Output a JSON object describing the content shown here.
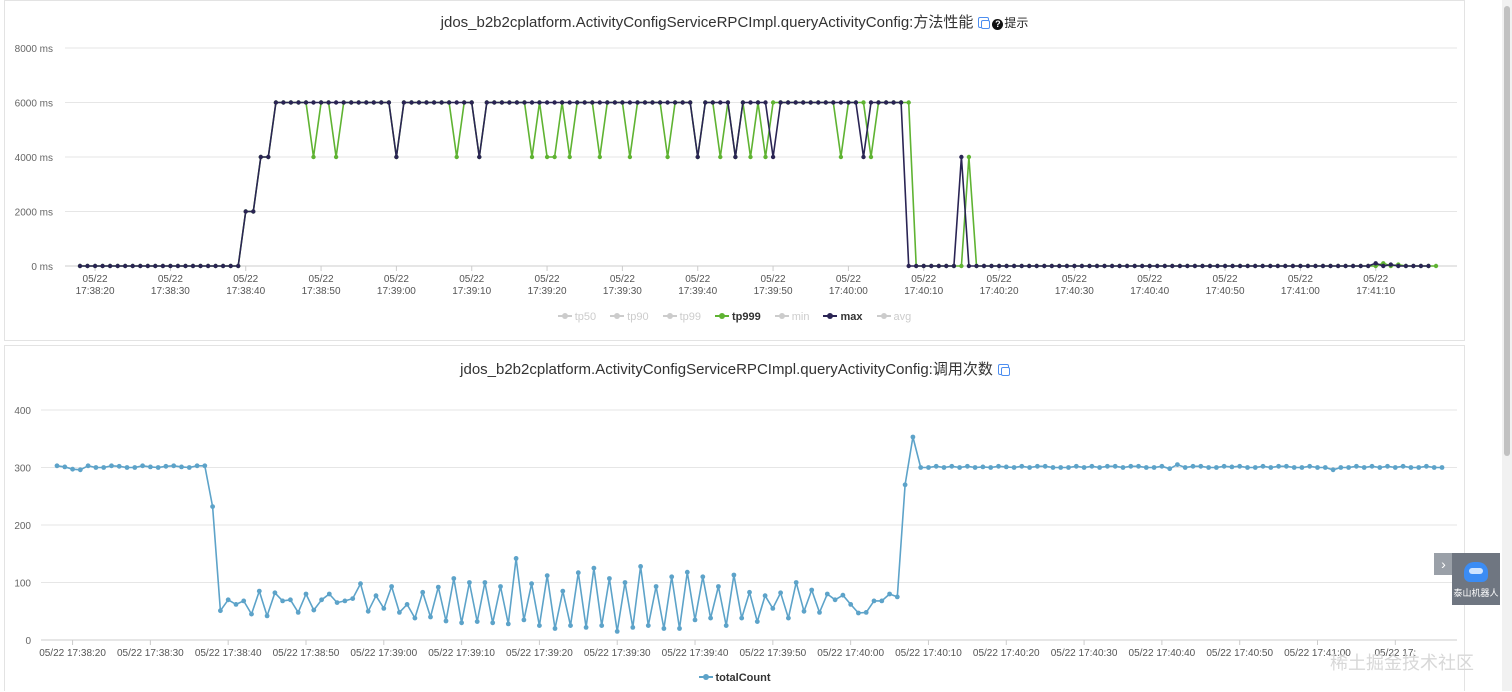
{
  "charts_panel1": {
    "title": "jdos_b2b2cplatform.ActivityConfigServiceRPCImpl.queryActivityConfig:方法性能",
    "help_label": "提示",
    "legend": [
      {
        "name": "tp50",
        "active": false,
        "color": "#cccccc"
      },
      {
        "name": "tp90",
        "active": false,
        "color": "#cccccc"
      },
      {
        "name": "tp99",
        "active": false,
        "color": "#cccccc"
      },
      {
        "name": "tp999",
        "active": true,
        "color": "#5fb332"
      },
      {
        "name": "min",
        "active": false,
        "color": "#cccccc"
      },
      {
        "name": "max",
        "active": true,
        "color": "#2a2454"
      },
      {
        "name": "avg",
        "active": false,
        "color": "#cccccc"
      }
    ]
  },
  "charts_panel2": {
    "title": "jdos_b2b2cplatform.ActivityConfigServiceRPCImpl.queryActivityConfig:调用次数",
    "legend": [
      {
        "name": "totalCount",
        "active": true,
        "color": "#5da3c9"
      }
    ]
  },
  "chart_data": [
    {
      "type": "line",
      "title": "jdos_b2b2cplatform.ActivityConfigServiceRPCImpl.queryActivityConfig:方法性能",
      "y_unit": "ms",
      "y_ticks": [
        "8000 ms",
        "6000 ms",
        "4000 ms",
        "2000 ms",
        "0 ms"
      ],
      "ylim": [
        0,
        8000
      ],
      "x_ticks": [
        "05/22 17:38:20",
        "05/22 17:38:30",
        "05/22 17:38:40",
        "05/22 17:38:50",
        "05/22 17:39:00",
        "05/22 17:39:10",
        "05/22 17:39:20",
        "05/22 17:39:30",
        "05/22 17:39:40",
        "05/22 17:39:50",
        "05/22 17:40:00",
        "05/22 17:40:10",
        "05/22 17:40:20",
        "05/22 17:40:30",
        "05/22 17:40:40",
        "05/22 17:40:50",
        "05/22 17:41:00",
        "05/22 17:41:10"
      ],
      "x_start": "05/22 17:38:18",
      "x_step_seconds": 1,
      "series": [
        {
          "name": "tp999",
          "values": [
            0,
            0,
            0,
            0,
            0,
            0,
            0,
            0,
            0,
            0,
            0,
            0,
            0,
            0,
            0,
            0,
            0,
            0,
            0,
            0,
            0,
            0,
            2000,
            2000,
            4000,
            4000,
            6000,
            6000,
            6000,
            6000,
            6000,
            4000,
            6000,
            6000,
            4000,
            6000,
            6000,
            6000,
            6000,
            6000,
            6000,
            6000,
            4000,
            6000,
            6000,
            6000,
            6000,
            6000,
            6000,
            6000,
            4000,
            6000,
            6000,
            4000,
            6000,
            6000,
            6000,
            6000,
            6000,
            6000,
            4000,
            6000,
            4000,
            4000,
            6000,
            4000,
            6000,
            6000,
            6000,
            4000,
            6000,
            6000,
            6000,
            4000,
            6000,
            6000,
            6000,
            6000,
            4000,
            6000,
            6000,
            6000,
            4000,
            6000,
            6000,
            4000,
            6000,
            4000,
            6000,
            4000,
            6000,
            4000,
            6000,
            6000,
            6000,
            6000,
            6000,
            6000,
            6000,
            6000,
            6000,
            4000,
            6000,
            6000,
            6000,
            4000,
            6000,
            6000,
            6000,
            6000,
            6000,
            0,
            0,
            0,
            0,
            0,
            0,
            0,
            4000,
            0,
            0,
            0,
            0,
            0,
            0,
            0,
            0,
            0,
            0,
            0,
            0,
            0,
            0,
            0,
            0,
            0,
            0,
            0,
            0,
            0,
            0,
            0,
            0,
            0,
            0,
            0,
            0,
            0,
            0,
            0,
            0,
            0,
            0,
            0,
            0,
            0,
            0,
            0,
            0,
            0,
            0,
            0,
            0,
            0,
            0,
            0,
            0,
            0,
            0,
            0,
            0,
            0,
            0,
            100,
            0,
            50,
            0,
            0,
            0,
            0,
            0
          ]
        },
        {
          "name": "max",
          "values": [
            0,
            0,
            0,
            0,
            0,
            0,
            0,
            0,
            0,
            0,
            0,
            0,
            0,
            0,
            0,
            0,
            0,
            0,
            0,
            0,
            0,
            0,
            2000,
            2000,
            4000,
            4000,
            6000,
            6000,
            6000,
            6000,
            6000,
            6000,
            6000,
            6000,
            6000,
            6000,
            6000,
            6000,
            6000,
            6000,
            6000,
            6000,
            4000,
            6000,
            6000,
            6000,
            6000,
            6000,
            6000,
            6000,
            6000,
            6000,
            6000,
            4000,
            6000,
            6000,
            6000,
            6000,
            6000,
            6000,
            6000,
            6000,
            6000,
            6000,
            6000,
            6000,
            6000,
            6000,
            6000,
            6000,
            6000,
            6000,
            6000,
            6000,
            6000,
            6000,
            6000,
            6000,
            6000,
            6000,
            6000,
            6000,
            4000,
            6000,
            6000,
            6000,
            6000,
            4000,
            6000,
            6000,
            6000,
            6000,
            4000,
            6000,
            6000,
            6000,
            6000,
            6000,
            6000,
            6000,
            6000,
            6000,
            6000,
            6000,
            4000,
            6000,
            6000,
            6000,
            6000,
            6000,
            0,
            0,
            0,
            0,
            0,
            0,
            0,
            4000,
            0,
            0,
            0,
            0,
            0,
            0,
            0,
            0,
            0,
            0,
            0,
            0,
            0,
            0,
            0,
            0,
            0,
            0,
            0,
            0,
            0,
            0,
            0,
            0,
            0,
            0,
            0,
            0,
            0,
            0,
            0,
            0,
            0,
            0,
            0,
            0,
            0,
            0,
            0,
            0,
            0,
            0,
            0,
            0,
            0,
            0,
            0,
            0,
            0,
            0,
            0,
            0,
            0,
            0,
            100,
            0,
            50,
            0,
            0,
            0,
            0,
            0
          ]
        }
      ]
    },
    {
      "type": "line",
      "title": "jdos_b2b2cplatform.ActivityConfigServiceRPCImpl.queryActivityConfig:调用次数",
      "y_ticks": [
        "400",
        "300",
        "200",
        "100",
        "0"
      ],
      "ylim": [
        0,
        400
      ],
      "x_ticks": [
        "05/22 17:38:20",
        "05/22 17:38:30",
        "05/22 17:38:40",
        "05/22 17:38:50",
        "05/22 17:39:00",
        "05/22 17:39:10",
        "05/22 17:39:20",
        "05/22 17:39:30",
        "05/22 17:39:40",
        "05/22 17:39:50",
        "05/22 17:40:00",
        "05/22 17:40:10",
        "05/22 17:40:20",
        "05/22 17:40:30",
        "05/22 17:40:40",
        "05/22 17:40:50",
        "05/22 17:41:00",
        "05/22 17:"
      ],
      "x_start": "05/22 17:38:18",
      "x_step_seconds": 1,
      "series": [
        {
          "name": "totalCount",
          "values": [
            303,
            301,
            297,
            296,
            303,
            300,
            300,
            303,
            302,
            300,
            300,
            303,
            301,
            300,
            302,
            303,
            301,
            300,
            303,
            303,
            232,
            51,
            70,
            62,
            68,
            45,
            85,
            42,
            82,
            68,
            70,
            48,
            80,
            52,
            70,
            80,
            65,
            68,
            72,
            98,
            50,
            77,
            55,
            93,
            48,
            62,
            38,
            83,
            40,
            92,
            33,
            107,
            30,
            100,
            32,
            100,
            30,
            93,
            28,
            142,
            35,
            98,
            25,
            112,
            20,
            85,
            25,
            117,
            22,
            125,
            25,
            107,
            15,
            100,
            22,
            128,
            25,
            93,
            20,
            110,
            20,
            118,
            35,
            110,
            38,
            93,
            25,
            113,
            38,
            83,
            32,
            77,
            55,
            82,
            38,
            100,
            50,
            87,
            48,
            80,
            70,
            78,
            62,
            47,
            48,
            68,
            68,
            80,
            75,
            270,
            353,
            300,
            300,
            302,
            300,
            302,
            300,
            302,
            300,
            301,
            300,
            302,
            301,
            300,
            302,
            300,
            302,
            302,
            300,
            300,
            300,
            302,
            300,
            302,
            300,
            302,
            302,
            300,
            302,
            302,
            300,
            300,
            302,
            298,
            305,
            300,
            302,
            302,
            300,
            300,
            302,
            301,
            302,
            300,
            300,
            302,
            300,
            302,
            302,
            300,
            300,
            302,
            300,
            300,
            296,
            300,
            300,
            302,
            300,
            302,
            300,
            302,
            300,
            302,
            300,
            300,
            302,
            300,
            300
          ]
        }
      ]
    }
  ],
  "watermark": "稀土掘金技术社区",
  "robot_label": "泰山机器人"
}
